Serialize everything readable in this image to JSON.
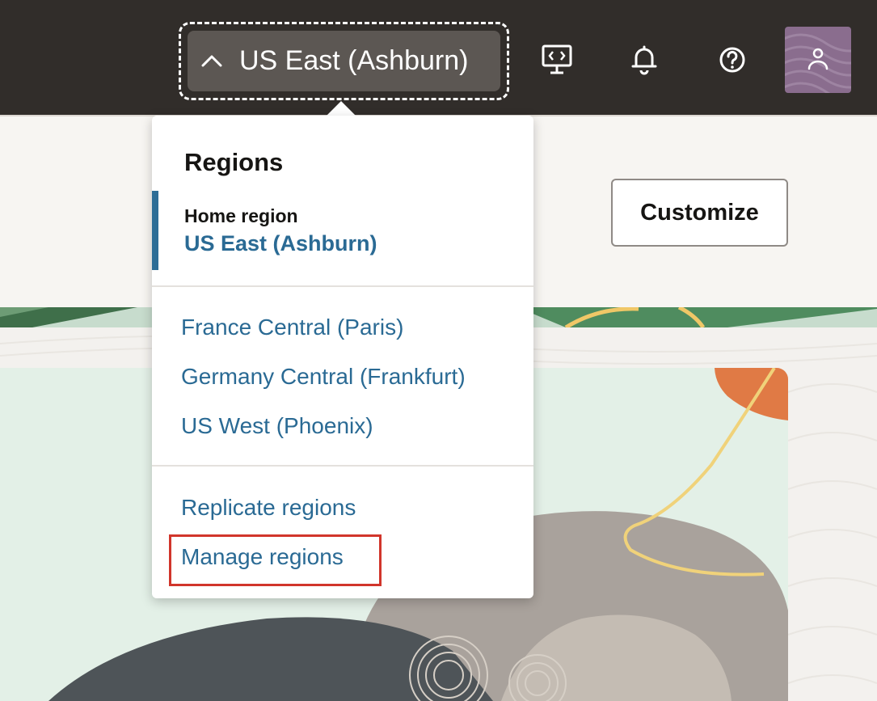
{
  "topbar": {
    "region_label": "US East (Ashburn)",
    "icons": {
      "region": "chevron-up-icon",
      "code_editor": "cloud-shell-icon",
      "notifications": "bell-icon",
      "help": "help-icon",
      "avatar": "user-icon"
    },
    "background": "#312d2a"
  },
  "page": {
    "customize_label": "Customize"
  },
  "regions_menu": {
    "title": "Regions",
    "home_region_caption": "Home region",
    "home_region_value": "US East (Ashburn)",
    "subscribed_regions": [
      "France Central (Paris)",
      "Germany Central (Frankfurt)",
      "US West (Phoenix)"
    ],
    "actions": [
      "Replicate regions",
      "Manage regions"
    ],
    "highlighted_action": "Manage regions",
    "link_color": "#2a6a94",
    "highlight_color": "#d1352b"
  }
}
